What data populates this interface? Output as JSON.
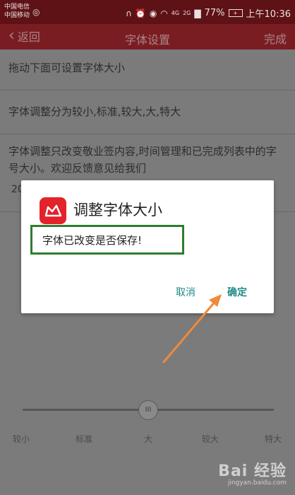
{
  "status_bar": {
    "carrier_1": "中国电信",
    "carrier_2": "中国移动",
    "weibo_icon": "weibo-icon",
    "network": "4G",
    "signal_label": "2G",
    "battery": "77%",
    "battery_badge": "+",
    "time": "上午10:36"
  },
  "app_bar": {
    "back_label": "返回",
    "title": "字体设置",
    "done_label": "完成"
  },
  "list": {
    "row1": "拖动下面可设置字体大小",
    "row2": "字体调整分为较小,标准,较大,大,特大",
    "row3": "字体调整只改变敬业签内容,时间管理和已完成列表中的字号大小。欢迎反馈意见给我们",
    "row3_partial": "20"
  },
  "font_sizes": {
    "labels": [
      "较小",
      "标准",
      "大",
      "较大",
      "特大"
    ],
    "selected_index": 2,
    "thumb_glyph": "III"
  },
  "dialog": {
    "title": "调整字体大小",
    "message": "字体已改变是否保存!",
    "cancel_label": "取消",
    "ok_label": "确定"
  },
  "watermark": {
    "main": "Bai 经验",
    "sub": "jingyan.baidu.com"
  },
  "colors": {
    "status_bar": "#5e1215",
    "app_bar": "#7a1d22",
    "dialog_bg": "#ffffff",
    "button_text": "#1f8a87",
    "highlight_border": "#2f7d2f",
    "arrow": "#f08a3c",
    "logo": "#e3222a"
  }
}
